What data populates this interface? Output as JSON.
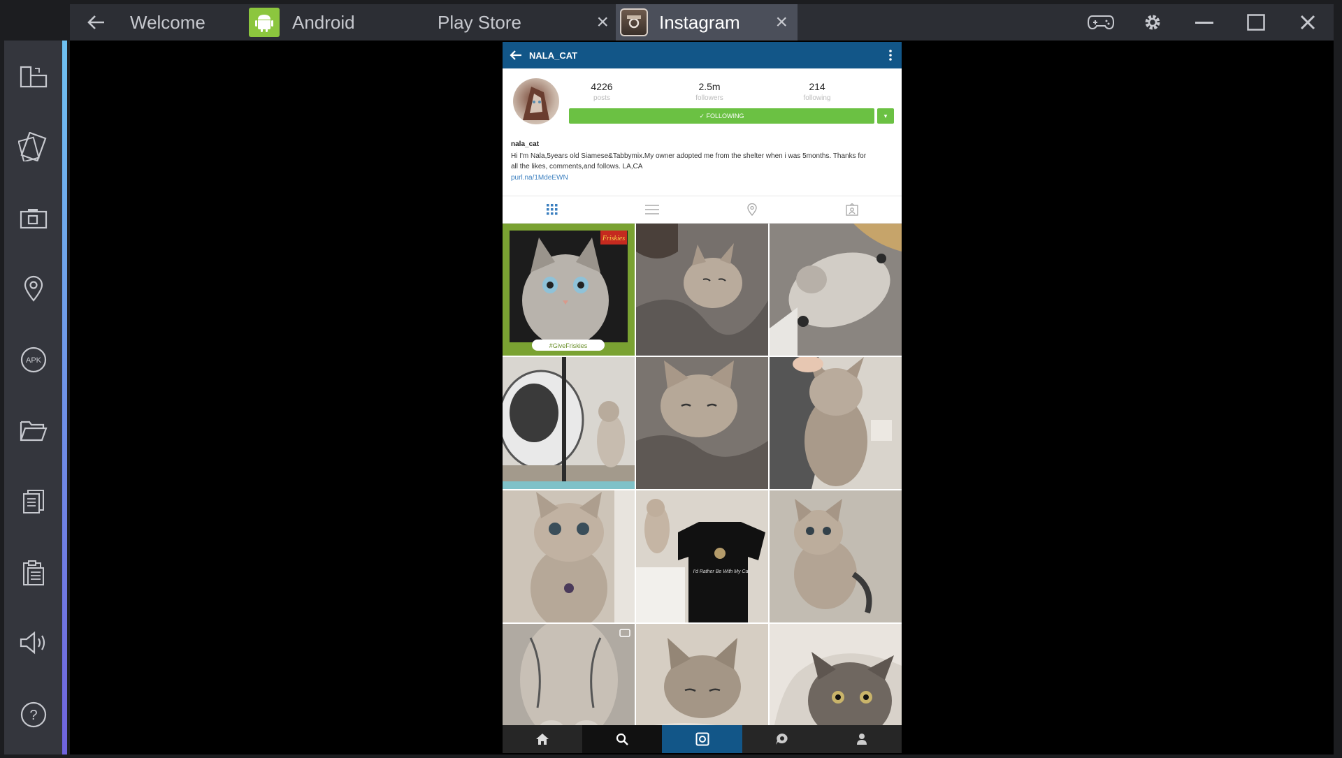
{
  "window": {
    "tabs": [
      {
        "label": "Welcome"
      },
      {
        "label": "Android"
      },
      {
        "label": "Play Store"
      },
      {
        "label": "Instagram"
      }
    ],
    "close_glyph": "×"
  },
  "sidebar": {
    "items": [
      {
        "icon": "screens-icon"
      },
      {
        "icon": "rotate-icon"
      },
      {
        "icon": "camera-icon"
      },
      {
        "icon": "location-icon"
      },
      {
        "icon": "apk-icon",
        "label": "APK"
      },
      {
        "icon": "folder-icon"
      },
      {
        "icon": "copy-icon"
      },
      {
        "icon": "paste-icon"
      },
      {
        "icon": "volume-icon"
      },
      {
        "icon": "help-icon",
        "label": "?"
      }
    ]
  },
  "instagram": {
    "header_username": "NALA_CAT",
    "stats": [
      {
        "value": "4226",
        "label": "posts"
      },
      {
        "value": "2.5m",
        "label": "followers"
      },
      {
        "value": "214",
        "label": "following"
      }
    ],
    "follow_button": "✓ FOLLOWING",
    "follow_dropdown": "▾",
    "bio_name": "nala_cat",
    "bio_text": "Hi I'm Nala,5years old Siamese&Tabbymix.My owner adopted me from the shelter when i was 5months. Thanks for all the likes, comments,and follows. LA,CA",
    "bio_link": "purl.na/1MdeEWN",
    "tile_badge": "Friskies",
    "tile_caption": "#GiveFriskies",
    "shirt_text": "I'd Rather Be With My Cat"
  },
  "colors": {
    "instagram_blue": "#125688",
    "follow_green": "#6bc143",
    "sidebar_accent_top": "#6ec0f0",
    "sidebar_accent_bottom": "#6f63dd",
    "android_green": "#8cc63e"
  }
}
